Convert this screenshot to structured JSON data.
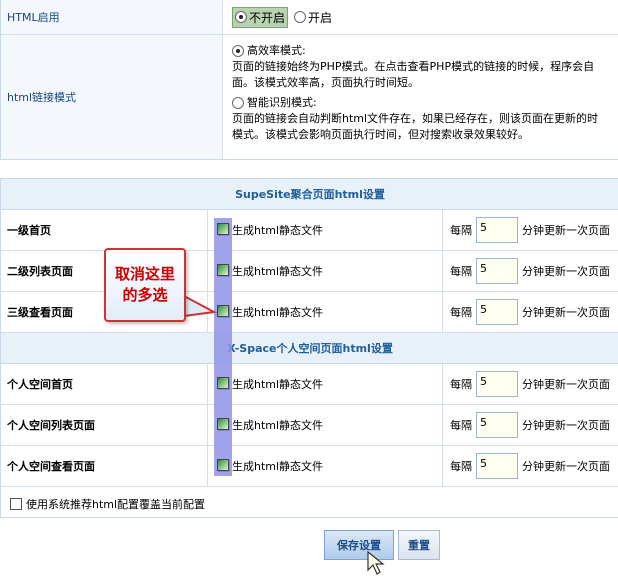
{
  "settings": {
    "html_enable": {
      "label": "HTML启用",
      "options": [
        "不开启",
        "开启"
      ],
      "selected": 0
    },
    "html_link_mode": {
      "label": "html链接模式",
      "option1": "高效率模式:",
      "option1_desc": [
        "页面的链接始终为PHP模式。在点击查看PHP模式的链接的时候，程序会自",
        "面。该模式效率高，页面执行时间短。"
      ],
      "option2": "智能识别模式:",
      "option2_desc": [
        "页面的链接会自动判断html文件存在，如果已经存在，则该页面在更新的时",
        "模式。该模式会影响页面执行时间，但对搜索收录效果较好。"
      ],
      "selected": 0
    }
  },
  "supesite": {
    "title": "SupeSite聚合页面html设置",
    "rows": [
      {
        "label": "一级首页",
        "gen": "生成html静态文件",
        "every": "每隔",
        "value": "5",
        "suffix": "分钟更新一次页面"
      },
      {
        "label": "二级列表页面",
        "gen": "生成html静态文件",
        "every": "每隔",
        "value": "5",
        "suffix": "分钟更新一次页面"
      },
      {
        "label": "三级查看页面",
        "gen": "生成html静态文件",
        "every": "每隔",
        "value": "5",
        "suffix": "分钟更新一次页面"
      }
    ]
  },
  "xspace": {
    "title": "X-Space个人空间页面html设置",
    "rows": [
      {
        "label": "个人空间首页",
        "gen": "生成html静态文件",
        "every": "每隔",
        "value": "5",
        "suffix": "分钟更新一次页面"
      },
      {
        "label": "个人空间列表页面",
        "gen": "生成html静态文件",
        "every": "每隔",
        "value": "5",
        "suffix": "分钟更新一次页面"
      },
      {
        "label": "个人空间查看页面",
        "gen": "生成html静态文件",
        "every": "每隔",
        "value": "5",
        "suffix": "分钟更新一次页面"
      }
    ]
  },
  "cover_option": "使用系统推荐html配置覆盖当前配置",
  "buttons": {
    "save": "保存设置",
    "reset": "重置"
  },
  "callout": {
    "line1": "取消这里",
    "line2": "的多选"
  },
  "colors": {
    "accent": "#1f5f9a",
    "callout_border": "#cc3333",
    "highlight": "#8f93e8"
  }
}
